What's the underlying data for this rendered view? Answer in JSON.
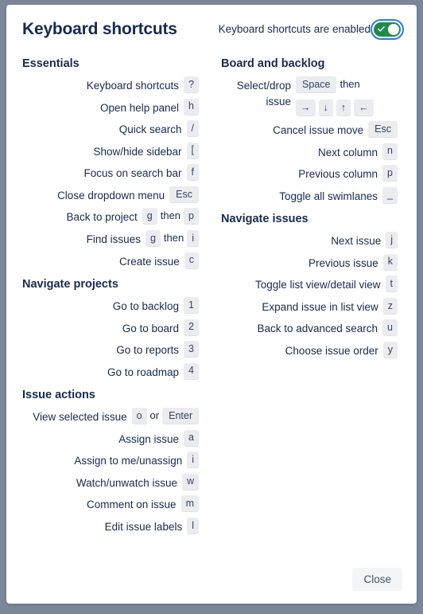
{
  "dialog": {
    "title": "Keyboard shortcuts",
    "toggle_label": "Keyboard shortcuts are enabled",
    "toggle_state": "on",
    "toggle_on_color": "#1f8a4c",
    "focus_ring_color": "#2a7de1",
    "close_label": "Close",
    "text_color": "#172b4d",
    "key_chip_bg": "#ebecf0",
    "backdrop_color": "#7b8699"
  },
  "columns": {
    "left": [
      {
        "title": "Essentials",
        "rows": [
          {
            "desc": "Keyboard shortcuts",
            "keys": [
              {
                "type": "key",
                "label": "?"
              }
            ]
          },
          {
            "desc": "Open help panel",
            "keys": [
              {
                "type": "key",
                "label": "h"
              }
            ]
          },
          {
            "desc": "Quick search",
            "keys": [
              {
                "type": "key",
                "label": "/"
              }
            ]
          },
          {
            "desc": "Show/hide sidebar",
            "keys": [
              {
                "type": "key",
                "label": "["
              }
            ]
          },
          {
            "desc": "Focus on search bar",
            "keys": [
              {
                "type": "key",
                "label": "f"
              }
            ]
          },
          {
            "desc": "Close dropdown menu",
            "keys": [
              {
                "type": "key",
                "label": "Esc",
                "wide": true
              }
            ]
          },
          {
            "desc": "Back to project",
            "keys": [
              {
                "type": "key",
                "label": "g"
              },
              {
                "type": "sep",
                "label": "then"
              },
              {
                "type": "key",
                "label": "p"
              }
            ]
          },
          {
            "desc": "Find issues",
            "keys": [
              {
                "type": "key",
                "label": "g"
              },
              {
                "type": "sep",
                "label": "then"
              },
              {
                "type": "key",
                "label": "i"
              }
            ]
          },
          {
            "desc": "Create issue",
            "keys": [
              {
                "type": "key",
                "label": "c"
              }
            ]
          }
        ]
      },
      {
        "title": "Navigate projects",
        "rows": [
          {
            "desc": "Go to backlog",
            "keys": [
              {
                "type": "key",
                "label": "1"
              }
            ]
          },
          {
            "desc": "Go to board",
            "keys": [
              {
                "type": "key",
                "label": "2"
              }
            ]
          },
          {
            "desc": "Go to reports",
            "keys": [
              {
                "type": "key",
                "label": "3"
              }
            ]
          },
          {
            "desc": "Go to roadmap",
            "keys": [
              {
                "type": "key",
                "label": "4"
              }
            ]
          }
        ]
      },
      {
        "title": "Issue actions",
        "rows": [
          {
            "desc": "View selected issue",
            "keys": [
              {
                "type": "key",
                "label": "o"
              },
              {
                "type": "sep",
                "label": "or"
              },
              {
                "type": "key",
                "label": "Enter",
                "wide": true
              }
            ]
          },
          {
            "desc": "Assign issue",
            "keys": [
              {
                "type": "key",
                "label": "a"
              }
            ]
          },
          {
            "desc": "Assign to me/unassign",
            "keys": [
              {
                "type": "key",
                "label": "i"
              }
            ]
          },
          {
            "desc": "Watch/unwatch issue",
            "keys": [
              {
                "type": "key",
                "label": "w"
              }
            ]
          },
          {
            "desc": "Comment on issue",
            "keys": [
              {
                "type": "key",
                "label": "m"
              }
            ]
          },
          {
            "desc": "Edit issue labels",
            "keys": [
              {
                "type": "key",
                "label": "l"
              }
            ]
          }
        ]
      }
    ],
    "right": [
      {
        "title": "Board and backlog",
        "rows": [
          {
            "desc": "Select/drop issue",
            "keys": [
              {
                "type": "key",
                "label": "Space",
                "wide": true
              },
              {
                "type": "sep",
                "label": "then"
              },
              {
                "type": "break"
              },
              {
                "type": "key",
                "label": "→"
              },
              {
                "type": "key",
                "label": "↓"
              },
              {
                "type": "key",
                "label": "↑"
              },
              {
                "type": "key",
                "label": "←"
              }
            ]
          },
          {
            "desc": "Cancel issue move",
            "keys": [
              {
                "type": "key",
                "label": "Esc",
                "wide": true
              }
            ]
          },
          {
            "desc": "Next column",
            "keys": [
              {
                "type": "key",
                "label": "n"
              }
            ]
          },
          {
            "desc": "Previous column",
            "keys": [
              {
                "type": "key",
                "label": "p"
              }
            ]
          },
          {
            "desc": "Toggle all swimlanes",
            "keys": [
              {
                "type": "key",
                "label": "_"
              }
            ]
          }
        ]
      },
      {
        "title": "Navigate issues",
        "rows": [
          {
            "desc": "Next issue",
            "keys": [
              {
                "type": "key",
                "label": "j"
              }
            ]
          },
          {
            "desc": "Previous issue",
            "keys": [
              {
                "type": "key",
                "label": "k"
              }
            ]
          },
          {
            "desc": "Toggle list view/detail view",
            "keys": [
              {
                "type": "key",
                "label": "t"
              }
            ]
          },
          {
            "desc": "Expand issue in list view",
            "keys": [
              {
                "type": "key",
                "label": "z"
              }
            ]
          },
          {
            "desc": "Back to advanced search",
            "keys": [
              {
                "type": "key",
                "label": "u"
              }
            ]
          },
          {
            "desc": "Choose issue order",
            "keys": [
              {
                "type": "key",
                "label": "y"
              }
            ]
          }
        ]
      }
    ]
  }
}
